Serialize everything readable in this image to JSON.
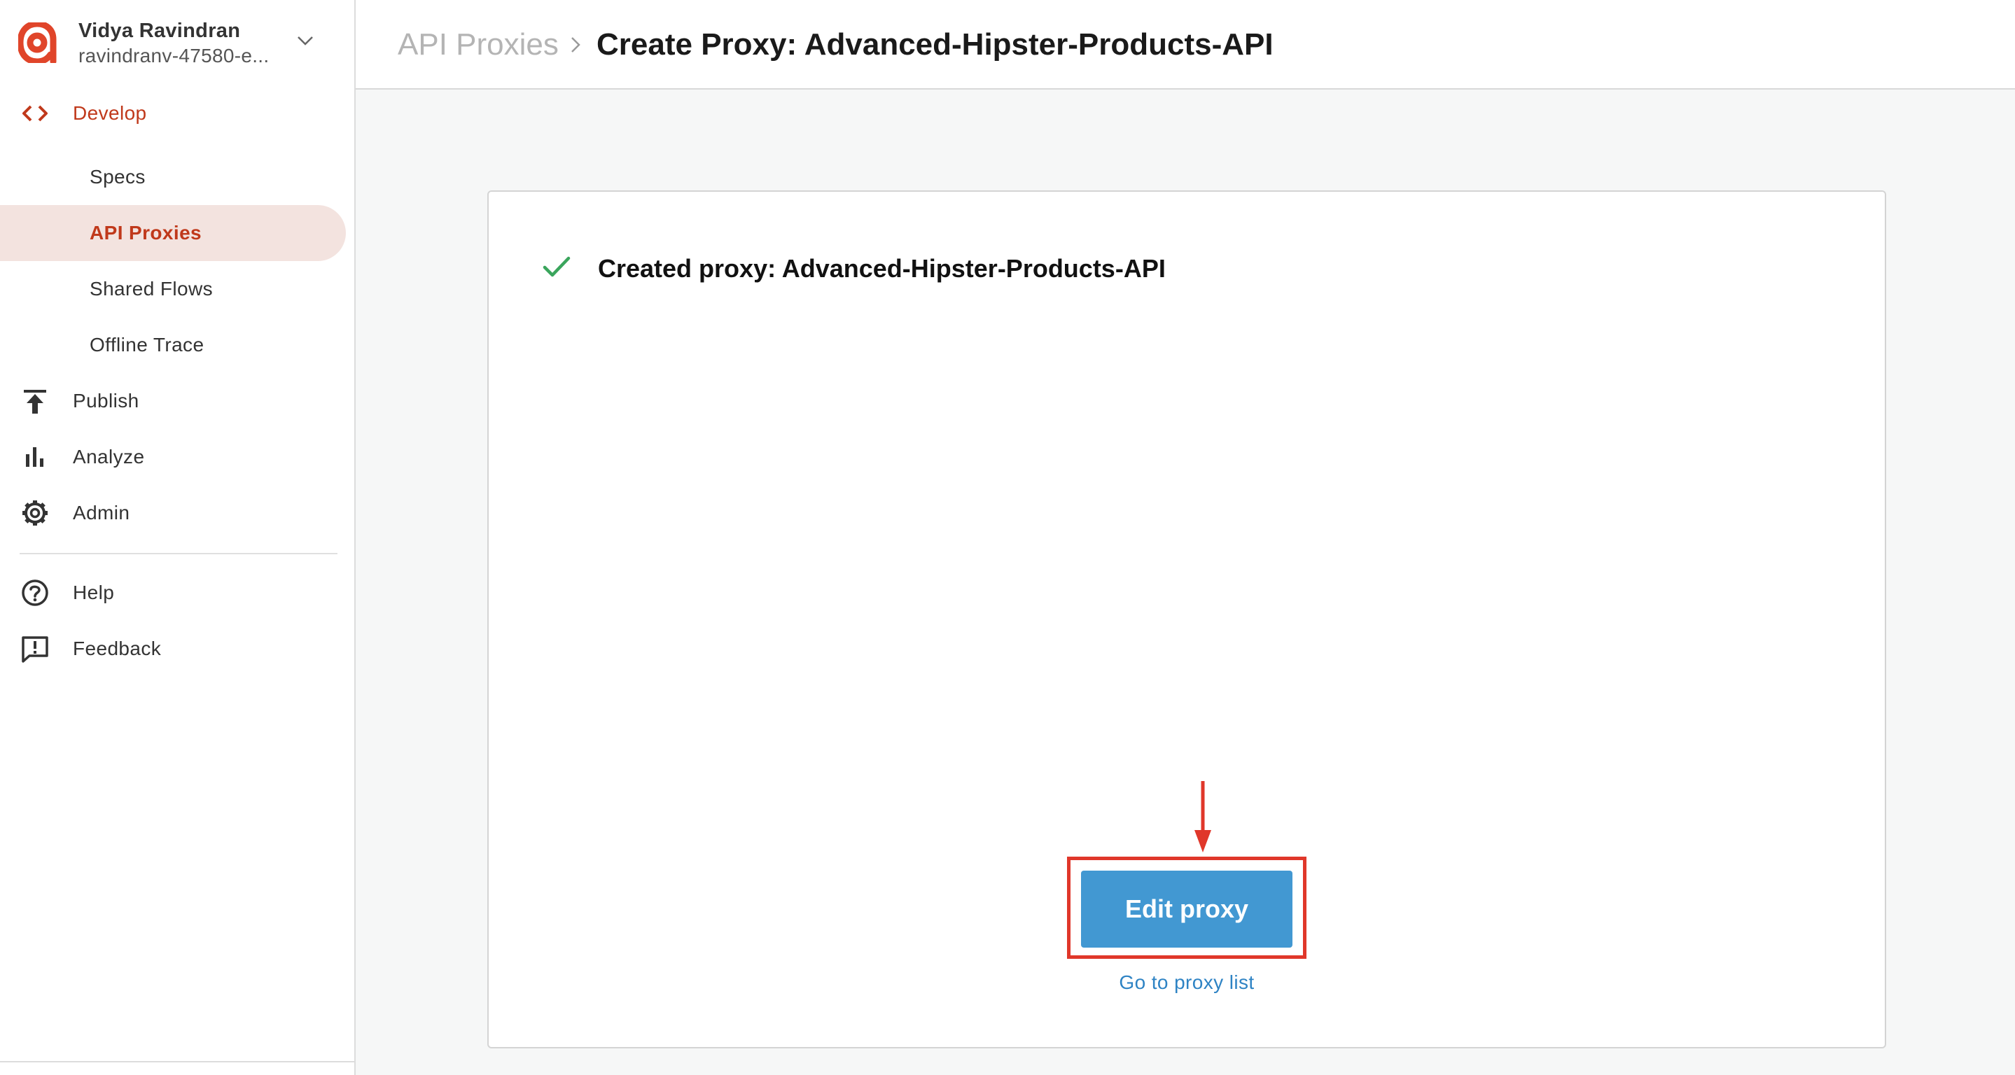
{
  "account": {
    "name": "Vidya Ravindran",
    "org": "ravindranv-47580-e..."
  },
  "nav": {
    "develop": "Develop",
    "develop_items": [
      {
        "label": "Specs"
      },
      {
        "label": "API Proxies",
        "active": true
      },
      {
        "label": "Shared Flows"
      },
      {
        "label": "Offline Trace"
      }
    ],
    "publish": "Publish",
    "analyze": "Analyze",
    "admin": "Admin",
    "help": "Help",
    "feedback": "Feedback",
    "icons": {
      "develop": "code-brackets-icon",
      "publish": "publish-upload-icon",
      "analyze": "bar-chart-icon",
      "admin": "gear-icon",
      "help": "help-circle-icon",
      "feedback": "feedback-icon"
    }
  },
  "header": {
    "breadcrumb_parent": "API Proxies",
    "title": "Create Proxy: Advanced-Hipster-Products-API"
  },
  "main": {
    "status_text": "Created proxy: Advanced-Hipster-Products-API",
    "edit_button": "Edit proxy",
    "proxy_list_link": "Go to proxy list"
  },
  "colors": {
    "brand": "#e0452a",
    "active_nav": "#c0391b",
    "active_nav_bg": "#f3e3df",
    "primary_button": "#4298d2",
    "link": "#2e83c4",
    "success_check": "#3aa55c",
    "annotation": "#e0372a"
  }
}
